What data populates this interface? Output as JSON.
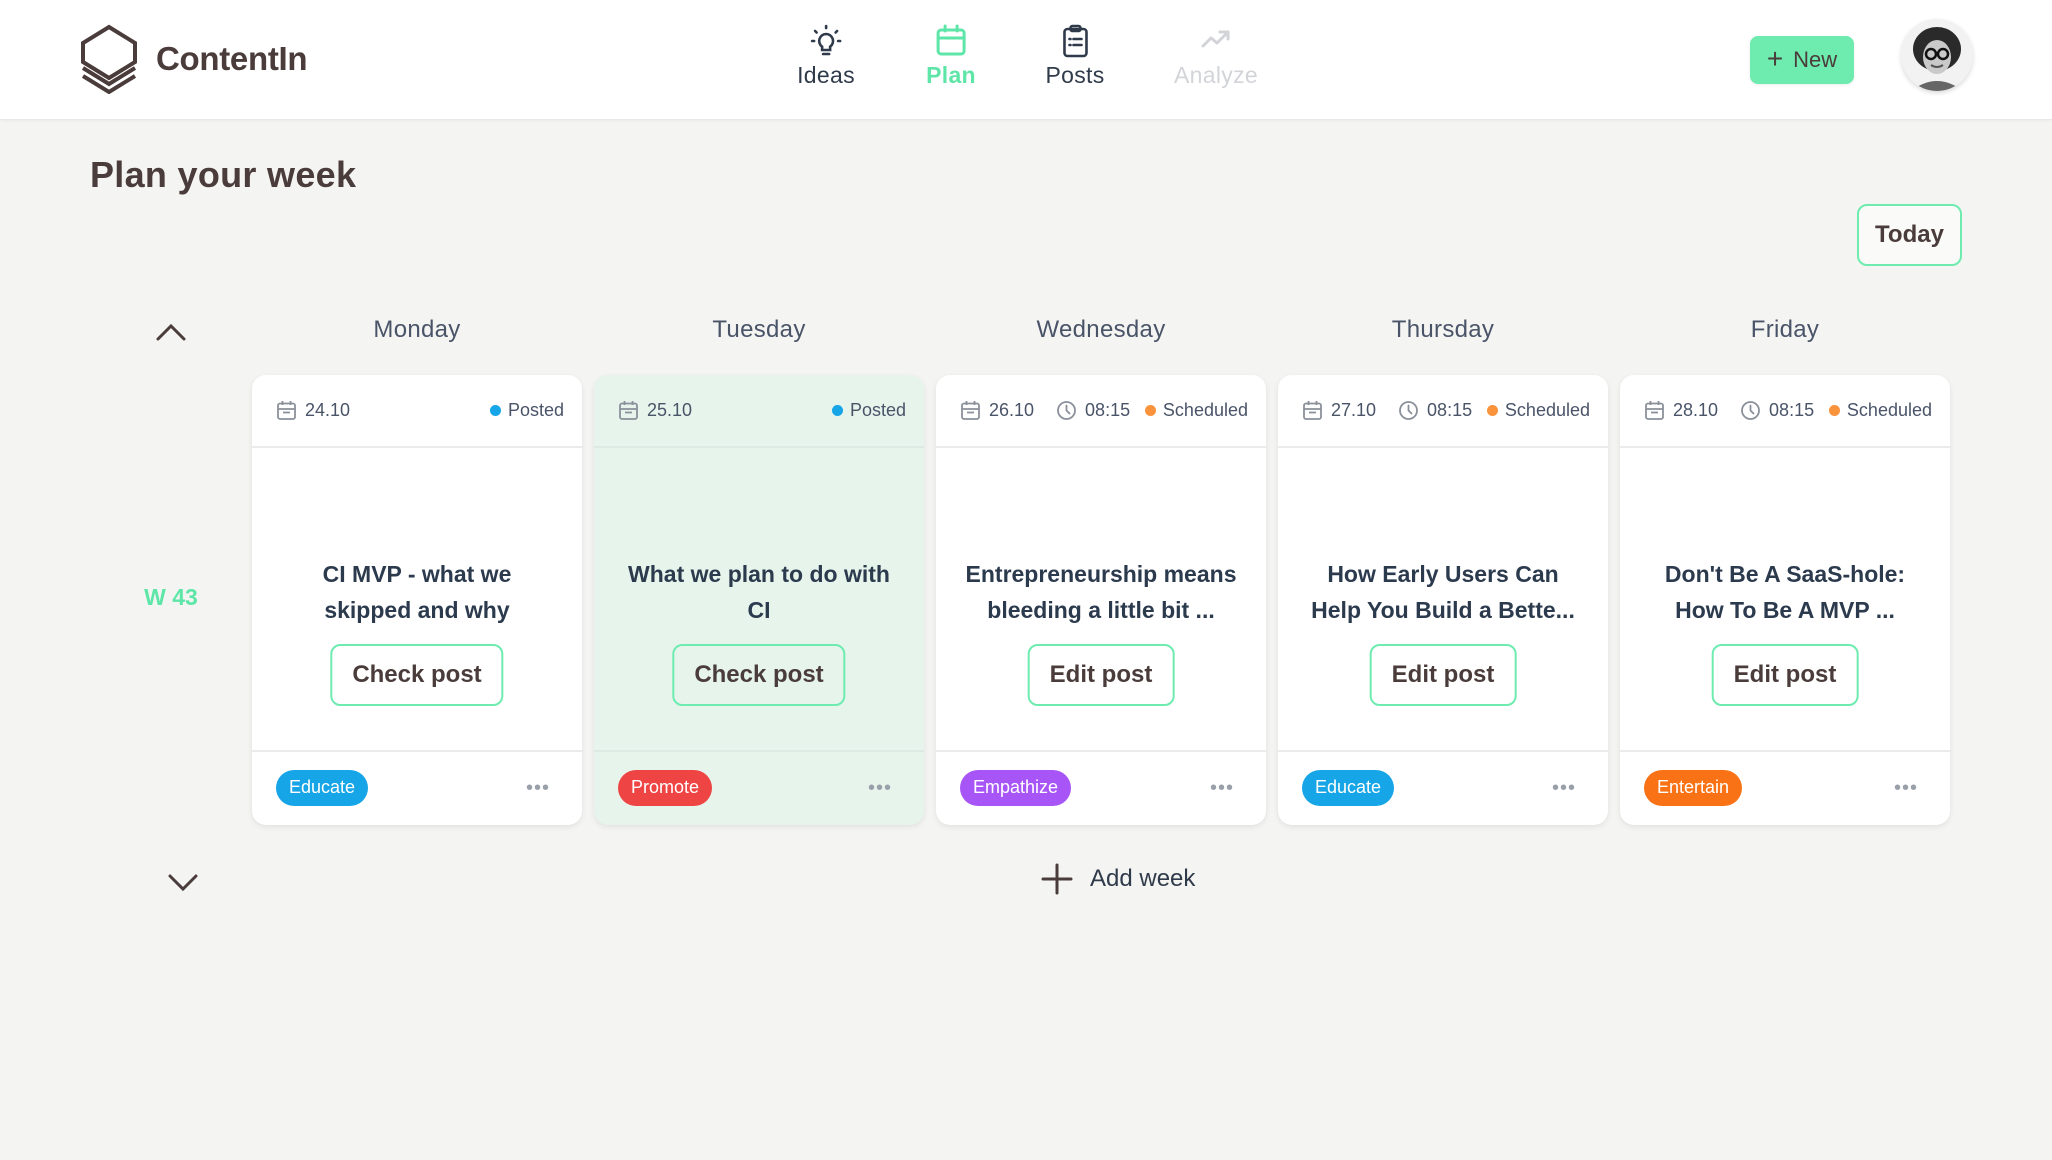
{
  "app": {
    "name": "ContentIn",
    "accent_color": "#5ee6a8"
  },
  "nav": {
    "items": [
      {
        "label": "Ideas",
        "icon": "lightbulb-icon",
        "state": "default"
      },
      {
        "label": "Plan",
        "icon": "calendar-icon",
        "state": "active"
      },
      {
        "label": "Posts",
        "icon": "clipboard-list-icon",
        "state": "default"
      },
      {
        "label": "Analyze",
        "icon": "trend-up-icon",
        "state": "disabled"
      }
    ]
  },
  "header": {
    "new_button": "New",
    "new_icon": "plus-icon",
    "avatar": "user-avatar"
  },
  "page": {
    "title": "Plan your week",
    "today_button": "Today"
  },
  "week": {
    "label": "W 43",
    "prev_icon": "chevron-up-icon",
    "next_icon": "chevron-down-icon",
    "add_week_label": "Add week",
    "days": [
      {
        "day": "Monday",
        "date": "24.10",
        "time": null,
        "status": "Posted",
        "status_color": "#16a5e6",
        "title": "CI MVP - what we skipped and why",
        "action": "Check post",
        "tag": "Educate",
        "tag_color": "#16a5e6",
        "highlighted": false
      },
      {
        "day": "Tuesday",
        "date": "25.10",
        "time": null,
        "status": "Posted",
        "status_color": "#16a5e6",
        "title": "What we plan to do with CI",
        "action": "Check post",
        "tag": "Promote",
        "tag_color": "#ee4444",
        "highlighted": true
      },
      {
        "day": "Wednesday",
        "date": "26.10",
        "time": "08:15",
        "status": "Scheduled",
        "status_color": "#fb923c",
        "title": "Entrepreneurship means bleeding a little bit ...",
        "action": "Edit post",
        "tag": "Empathize",
        "tag_color": "#a855f7",
        "highlighted": false
      },
      {
        "day": "Thursday",
        "date": "27.10",
        "time": "08:15",
        "status": "Scheduled",
        "status_color": "#fb923c",
        "title": "How Early Users Can Help You Build a Bette...",
        "action": "Edit post",
        "tag": "Educate",
        "tag_color": "#16a5e6",
        "highlighted": false
      },
      {
        "day": "Friday",
        "date": "28.10",
        "time": "08:15",
        "status": "Scheduled",
        "status_color": "#fb923c",
        "title": "Don't Be A SaaS-hole: How To Be A MVP ...",
        "action": "Edit post",
        "tag": "Entertain",
        "tag_color": "#f97316",
        "highlighted": false
      }
    ]
  }
}
